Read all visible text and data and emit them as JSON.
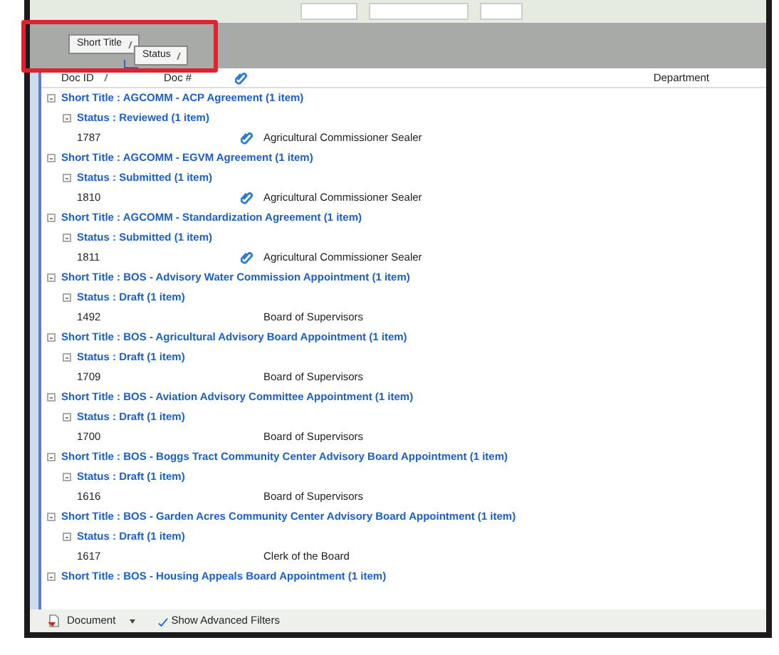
{
  "group_panel": {
    "chips": [
      {
        "label": "Short Title",
        "sorted": true
      },
      {
        "label": "Status",
        "sorted": true
      }
    ]
  },
  "columns": [
    {
      "label": "Doc ID",
      "kind": "text",
      "sorted": true
    },
    {
      "label": "Doc #",
      "kind": "text",
      "sorted": false
    },
    {
      "kind": "attachment",
      "sorted": false
    },
    {
      "label": "Department",
      "kind": "text",
      "sorted": false
    }
  ],
  "groups": [
    {
      "title": "Short Title : AGCOMM - ACP Agreement (1 item)",
      "children": [
        {
          "title": "Status : Reviewed (1 item)",
          "rows": [
            {
              "doc_id": "1787",
              "attachment": true,
              "department": "Agricultural Commissioner Sealer"
            }
          ]
        }
      ]
    },
    {
      "title": "Short Title : AGCOMM - EGVM Agreement (1 item)",
      "children": [
        {
          "title": "Status : Submitted (1 item)",
          "rows": [
            {
              "doc_id": "1810",
              "attachment": true,
              "department": "Agricultural Commissioner Sealer"
            }
          ]
        }
      ]
    },
    {
      "title": "Short Title : AGCOMM - Standardization Agreement (1 item)",
      "children": [
        {
          "title": "Status : Submitted (1 item)",
          "rows": [
            {
              "doc_id": "1811",
              "attachment": true,
              "department": "Agricultural Commissioner Sealer"
            }
          ]
        }
      ]
    },
    {
      "title": "Short Title : BOS - Advisory Water Commission Appointment (1 item)",
      "children": [
        {
          "title": "Status : Draft (1 item)",
          "rows": [
            {
              "doc_id": "1492",
              "attachment": false,
              "department": "Board of Supervisors"
            }
          ]
        }
      ]
    },
    {
      "title": "Short Title : BOS - Agricultural Advisory Board Appointment (1 item)",
      "children": [
        {
          "title": "Status : Draft (1 item)",
          "rows": [
            {
              "doc_id": "1709",
              "attachment": false,
              "department": "Board of Supervisors"
            }
          ]
        }
      ]
    },
    {
      "title": "Short Title : BOS - Aviation Advisory Committee Appointment (1 item)",
      "children": [
        {
          "title": "Status : Draft (1 item)",
          "rows": [
            {
              "doc_id": "1700",
              "attachment": false,
              "department": "Board of Supervisors"
            }
          ]
        }
      ]
    },
    {
      "title": "Short Title : BOS - Boggs Tract Community Center Advisory Board Appointment (1 item)",
      "children": [
        {
          "title": "Status : Draft (1 item)",
          "rows": [
            {
              "doc_id": "1616",
              "attachment": false,
              "department": "Board of Supervisors"
            }
          ]
        }
      ]
    },
    {
      "title": "Short Title : BOS - Garden Acres Community Center Advisory Board Appointment (1 item)",
      "children": [
        {
          "title": "Status : Draft (1 item)",
          "rows": [
            {
              "doc_id": "1617",
              "attachment": false,
              "department": "Clerk of the Board"
            }
          ]
        }
      ]
    },
    {
      "title": "Short Title : BOS - Housing Appeals Board Appointment (1 item)"
    }
  ],
  "footer": {
    "document_button": "Document",
    "advanced_filters": {
      "label": "Show Advanced Filters",
      "checked": true
    }
  }
}
